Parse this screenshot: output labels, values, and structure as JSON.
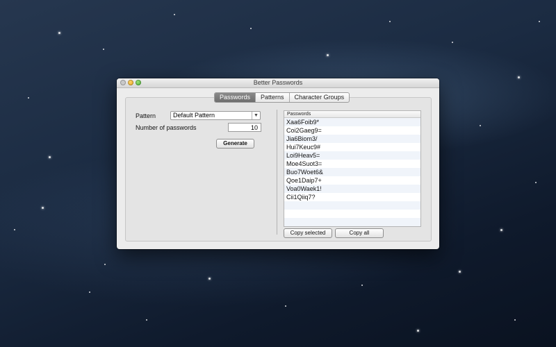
{
  "window": {
    "title": "Better Passwords"
  },
  "tabs": [
    {
      "label": "Passwords",
      "active": true
    },
    {
      "label": "Patterns",
      "active": false
    },
    {
      "label": "Character Groups",
      "active": false
    }
  ],
  "form": {
    "pattern_label": "Pattern",
    "pattern_value": "Default Pattern",
    "count_label": "Number of passwords",
    "count_value": "10",
    "generate_label": "Generate"
  },
  "list": {
    "header": "Passwords",
    "items": [
      "Xaa6Foib9*",
      "Coi2Gaeg9=",
      "Jia6Biom3/",
      "Hui7Keuc9#",
      "Loi9Heav5=",
      "Moe4Suot3=",
      "Buo7Woet6&",
      "Qoe1Daip7+",
      "Voa0Waek1!",
      "Cii1Qiiq7?"
    ],
    "empty_rows": 3
  },
  "actions": {
    "copy_selected": "Copy selected",
    "copy_all": "Copy all"
  },
  "colors": {
    "active_tab": "#7a7a7a",
    "window_bg": "#ececec"
  }
}
